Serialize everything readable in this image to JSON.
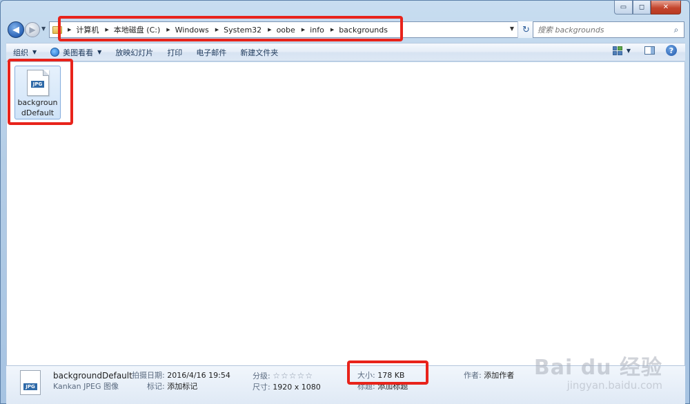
{
  "window": {
    "caption": {
      "minimize": "▭",
      "maximize": "◻",
      "close": "✕"
    }
  },
  "nav": {
    "back_glyph": "◀",
    "forward_glyph": "▶",
    "dropdown_glyph": "▼",
    "breadcrumb": [
      "计算机",
      "本地磁盘 (C:)",
      "Windows",
      "System32",
      "oobe",
      "info",
      "backgrounds"
    ],
    "separator_glyph": "▶",
    "refresh_glyph": "↻"
  },
  "search": {
    "placeholder": "搜索 backgrounds",
    "icon_glyph": "⌕"
  },
  "toolbar": {
    "organize": "组织",
    "meitu": "美图看看",
    "slideshow": "放映幻灯片",
    "print": "打印",
    "email": "电子邮件",
    "new_folder": "新建文件夹",
    "help_glyph": "?"
  },
  "files": [
    {
      "name": "backgroundDefault",
      "type_badge": "JPG"
    }
  ],
  "details": {
    "name": "backgroundDefault",
    "type": "Kankan JPEG 图像",
    "date_label": "拍摄日期:",
    "date_value": "2016/4/16 19:54",
    "tags_label": "标记:",
    "tags_value": "添加标记",
    "rating_label": "分级:",
    "rating_stars": "☆☆☆☆☆",
    "dimensions_label": "尺寸:",
    "dimensions_value": "1920 x 1080",
    "size_label": "大小:",
    "size_value": "178 KB",
    "title_label": "标题:",
    "title_value": "添加标题",
    "author_label": "作者:",
    "author_value": "添加作者"
  },
  "watermark": {
    "brand": "Bai du 经验",
    "url": "jingyan.baidu.com"
  },
  "colors": {
    "annotation": "#e8231b",
    "accent": "#2b64b7"
  }
}
